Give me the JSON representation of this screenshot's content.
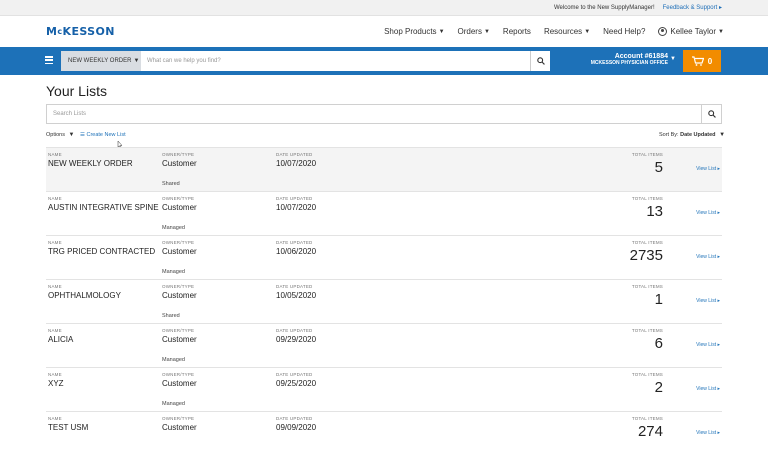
{
  "topbar": {
    "welcome": "Welcome to the New SupplyManager!",
    "feedback": "Feedback & Support ▸"
  },
  "header": {
    "logo": [
      "M",
      "c",
      "KESSON"
    ],
    "nav": [
      {
        "label": "Shop Products",
        "caret": true
      },
      {
        "label": "Orders",
        "caret": true
      },
      {
        "label": "Reports",
        "caret": false
      },
      {
        "label": "Resources",
        "caret": true
      },
      {
        "label": "Need Help?",
        "caret": false
      }
    ],
    "user": "Kellee Taylor"
  },
  "bluebar": {
    "order_select": "NEW WEEKLY ORDER",
    "search_placeholder": "What can we help you find?",
    "account_number": "Account #61884",
    "account_office": "MCKESSON PHYSICIAN OFFICE",
    "cart_count": "0"
  },
  "page": {
    "title": "Your Lists",
    "search_placeholder": "Search Lists",
    "options": "Options",
    "create_new": "Create New List",
    "sort_label": "Sort By:",
    "sort_value": "Date Updated"
  },
  "labels": {
    "name": "NAME",
    "owner": "OWNER/TYPE",
    "date": "DATE UPDATED",
    "total": "TOTAL ITEMS",
    "view": "View List ▸"
  },
  "lists": [
    {
      "name": "NEW WEEKLY ORDER",
      "owner": "Customer",
      "date": "10/07/2020",
      "type": "Shared",
      "total": "5"
    },
    {
      "name": "AUSTIN INTEGRATIVE SPINE",
      "owner": "Customer",
      "date": "10/07/2020",
      "type": "Managed",
      "total": "13"
    },
    {
      "name": "TRG PRICED CONTRACTED",
      "owner": "Customer",
      "date": "10/06/2020",
      "type": "Managed",
      "total": "2735"
    },
    {
      "name": "OPHTHALMOLOGY",
      "owner": "Customer",
      "date": "10/05/2020",
      "type": "Shared",
      "total": "1"
    },
    {
      "name": "ALICIA",
      "owner": "Customer",
      "date": "09/29/2020",
      "type": "Managed",
      "total": "6"
    },
    {
      "name": "XYZ",
      "owner": "Customer",
      "date": "09/25/2020",
      "type": "Managed",
      "total": "2"
    },
    {
      "name": "TEST USM",
      "owner": "Customer",
      "date": "09/09/2020",
      "type": "",
      "total": "274"
    }
  ]
}
